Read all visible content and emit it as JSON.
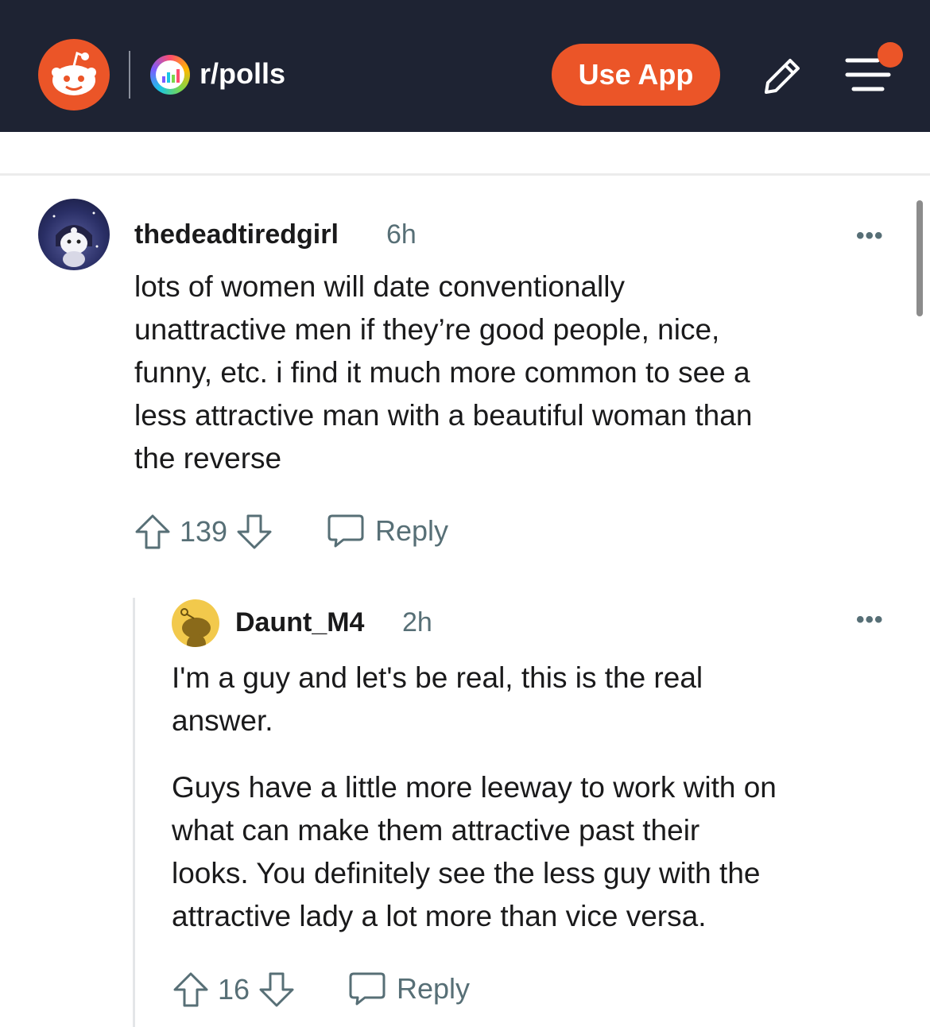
{
  "header": {
    "subreddit": "r/polls",
    "use_app_label": "Use App",
    "brand_color": "#eb5528",
    "background_color": "#1e2333"
  },
  "comments": [
    {
      "username": "thedeadtiredgirl",
      "time": "6h",
      "more": "•••",
      "lines": [
        "lots of women will date conventionally",
        "unattractive men if they’re good people, nice,",
        "funny, etc. i find it much more common to see a",
        "less attractive man with a beautiful woman than",
        "the reverse"
      ],
      "votes": "139",
      "reply_label": "Reply"
    },
    {
      "username": "Daunt_M4",
      "time": "2h",
      "more": "•••",
      "lines": [
        "I'm a guy and let's be real, this is the real",
        "answer."
      ],
      "lines2": [
        "Guys have a little more leeway to work with on",
        "what can make them attractive past their",
        "looks. You definitely see the less guy with the",
        "attractive lady a lot more than vice versa."
      ],
      "votes": "16",
      "reply_label": "Reply"
    }
  ],
  "icons": [
    "reddit-logo-icon",
    "subreddit-icon",
    "pencil-icon",
    "menu-icon",
    "upvote-icon",
    "downvote-icon",
    "reply-icon",
    "more-icon"
  ]
}
